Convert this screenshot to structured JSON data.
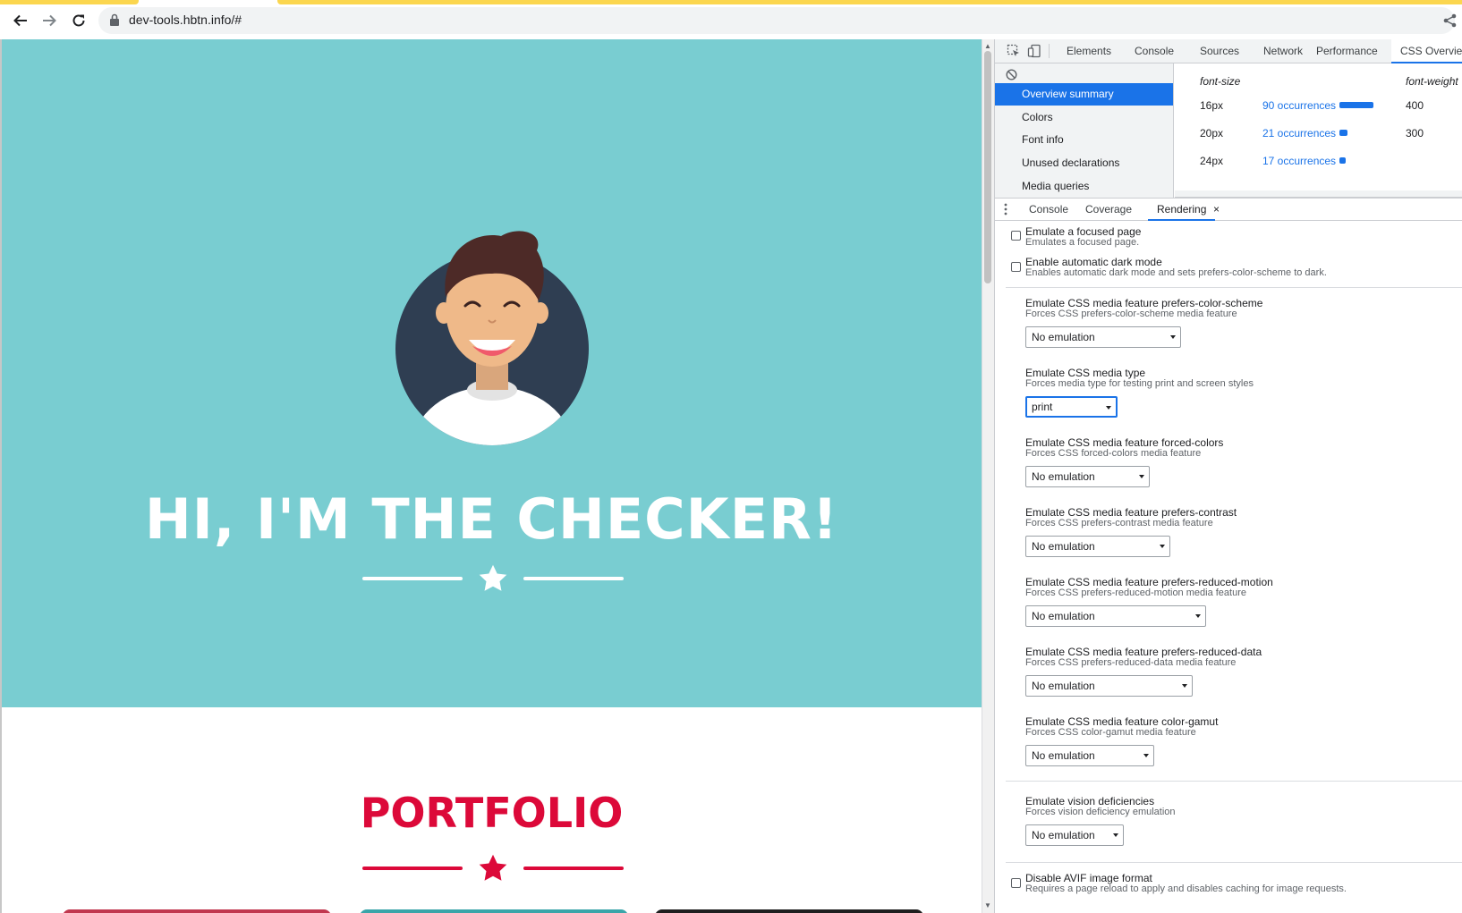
{
  "browser": {
    "url": "dev-tools.hbtn.info/#"
  },
  "page": {
    "hero_title": "HI, I'M THE CHECKER!",
    "portfolio_title": "PORTFOLIO",
    "colors": {
      "hero_bg": "#79cdd1",
      "accent": "#dc0939"
    }
  },
  "devtools": {
    "tabs": [
      "Elements",
      "Console",
      "Sources",
      "Network",
      "Performance",
      "CSS Overview"
    ],
    "active_tab": "CSS Overview",
    "overview_sidebar": [
      "Overview summary",
      "Colors",
      "Font info",
      "Unused declarations",
      "Media queries"
    ],
    "selected_sidebar_item": "Overview summary",
    "font_table": {
      "size_header": "font-size",
      "weight_header": "font-weight",
      "rows": [
        {
          "size": "16px",
          "occurrences": "90 occurrences",
          "bar_fraction": 1.0,
          "weight": "400"
        },
        {
          "size": "20px",
          "occurrences": "21 occurrences",
          "bar_fraction": 0.23,
          "weight": "300"
        },
        {
          "size": "24px",
          "occurrences": "17 occurrences",
          "bar_fraction": 0.19,
          "weight": ""
        }
      ]
    },
    "drawer_tabs": [
      "Console",
      "Coverage",
      "Rendering"
    ],
    "drawer_active": "Rendering",
    "drawer_close": "×",
    "rendering": {
      "focused_page": {
        "title": "Emulate a focused page",
        "desc": "Emulates a focused page.",
        "checked": false
      },
      "auto_dark": {
        "title": "Enable automatic dark mode",
        "desc": "Enables automatic dark mode and sets prefers-color-scheme to dark.",
        "checked": false
      },
      "color_scheme": {
        "title": "Emulate CSS media feature prefers-color-scheme",
        "desc": "Forces CSS prefers-color-scheme media feature",
        "value": "No emulation"
      },
      "media_type": {
        "title": "Emulate CSS media type",
        "desc": "Forces media type for testing print and screen styles",
        "value": "print"
      },
      "forced_colors": {
        "title": "Emulate CSS media feature forced-colors",
        "desc": "Forces CSS forced-colors media feature",
        "value": "No emulation"
      },
      "contrast": {
        "title": "Emulate CSS media feature prefers-contrast",
        "desc": "Forces CSS prefers-contrast media feature",
        "value": "No emulation"
      },
      "reduced_motion": {
        "title": "Emulate CSS media feature prefers-reduced-motion",
        "desc": "Forces CSS prefers-reduced-motion media feature",
        "value": "No emulation"
      },
      "reduced_data": {
        "title": "Emulate CSS media feature prefers-reduced-data",
        "desc": "Forces CSS prefers-reduced-data media feature",
        "value": "No emulation"
      },
      "color_gamut": {
        "title": "Emulate CSS media feature color-gamut",
        "desc": "Forces CSS color-gamut media feature",
        "value": "No emulation"
      },
      "vision": {
        "title": "Emulate vision deficiencies",
        "desc": "Forces vision deficiency emulation",
        "value": "No emulation"
      },
      "avif": {
        "title": "Disable AVIF image format",
        "desc": "Requires a page reload to apply and disables caching for image requests.",
        "checked": false
      }
    }
  }
}
